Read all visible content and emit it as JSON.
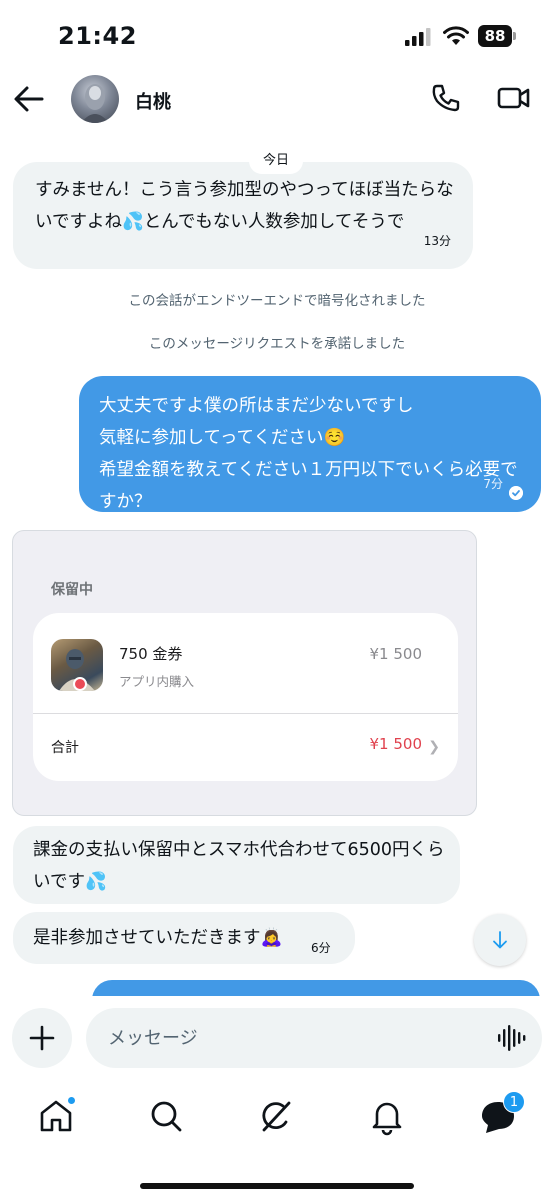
{
  "status_bar": {
    "time": "21:42",
    "battery": "88"
  },
  "header": {
    "contact_name": "白桃",
    "icons": [
      "back-arrow-icon",
      "phone-icon",
      "video-camera-icon"
    ]
  },
  "chat": {
    "day_label": "今日",
    "messages": [
      {
        "direction": "in",
        "text": "すみません！こう言う参加型のやつってほぼ当たらないですよね💦とんでもない人数参加してそうで",
        "time": "13分"
      },
      {
        "direction": "out",
        "text": "大丈夫ですよ僕の所はまだ少ないですし\n気軽に参加してってください☺️\n希望金額を教えてください１万円以下でいくら必要ですか？",
        "time": "7分",
        "read": true
      },
      {
        "direction": "in",
        "text": "課金の支払い保留中とスマホ代合わせて6500円くらいです💦"
      },
      {
        "direction": "in",
        "text": "是非参加させていただきます🙇‍♀️",
        "time": "6分"
      }
    ],
    "system_notes": [
      "この会話がエンドツーエンドで暗号化されました",
      "このメッセージリクエストを承諾しました"
    ],
    "payment_card": {
      "status": "保留中",
      "item_name": "750 金券",
      "item_sub": "アプリ内購入",
      "item_price": "¥1 500",
      "total_label": "合計",
      "total_price": "¥1 500"
    }
  },
  "composer": {
    "placeholder": "メッセージ"
  },
  "bottom_nav": {
    "items": [
      "home-icon",
      "search-icon",
      "grok-icon",
      "notifications-icon",
      "messages-icon"
    ],
    "messages_badge": "1"
  },
  "colors": {
    "accent": "#1d9bf0",
    "outgoing_bubble": "#4299e6",
    "incoming_bubble": "#eff3f4",
    "price_red": "#e0424e"
  }
}
